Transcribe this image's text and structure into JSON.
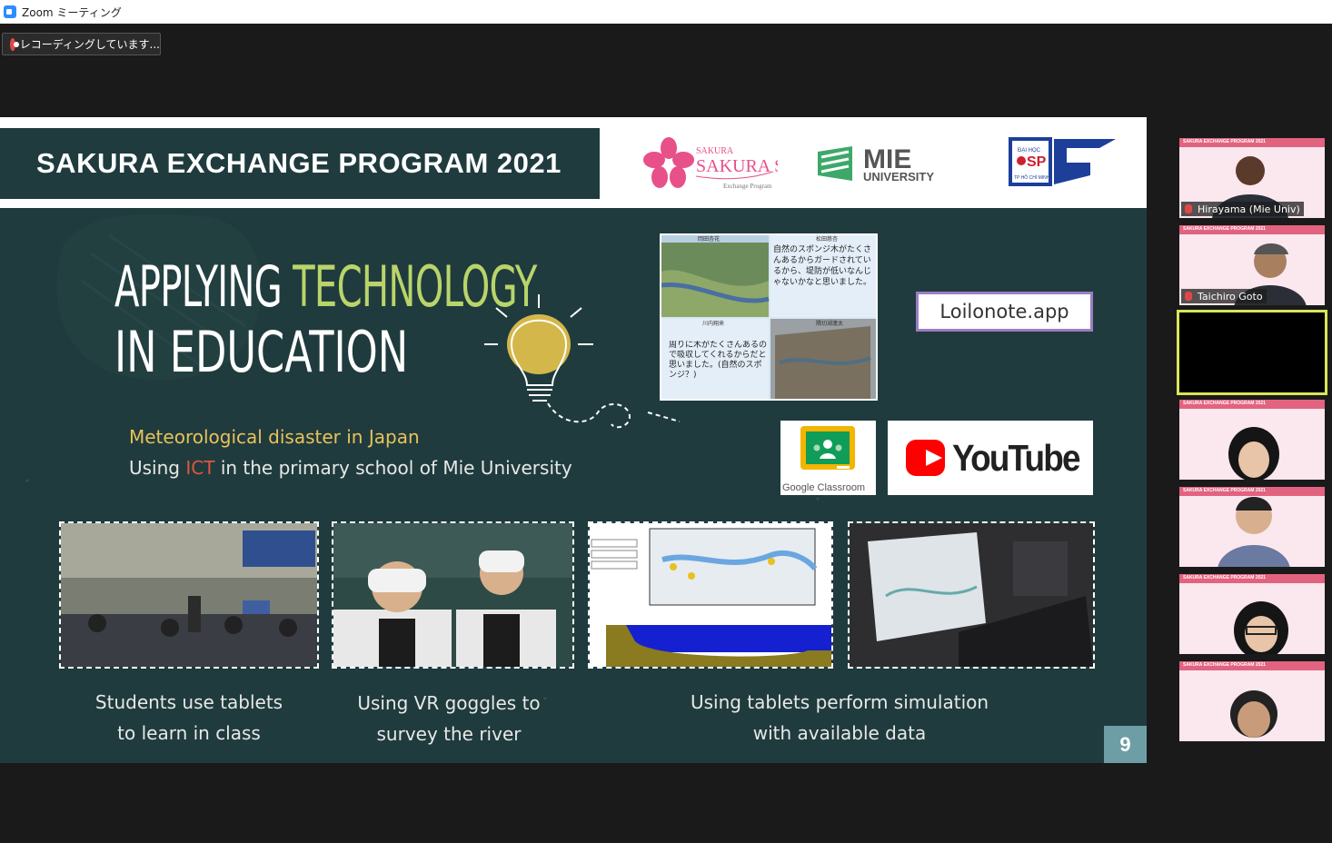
{
  "window": {
    "title": "Zoom ミーティング"
  },
  "recording": {
    "label": "レコーディングしています..."
  },
  "slide": {
    "header_title": "SAKURA EXCHANGE PROGRAM 2021",
    "title_white": "APPLYING",
    "title_green": "TECHNOLOGY",
    "title_line2": "IN EDUCATION",
    "subtitle1": "Meteorological disaster in Japan",
    "subtitle2_pre": "Using",
    "subtitle2_ict": "ICT",
    "subtitle2_post": "in the primary school of Mie University",
    "loilonote": "Loilonote.app",
    "google_classroom": "Google Classroom",
    "youtube": "YouTube",
    "captions": [
      {
        "line1": "Students use tablets",
        "line2": "to learn in class"
      },
      {
        "line1": "Using VR goggles to",
        "line2": "survey the river"
      },
      {
        "line1": "Using tablets perform simulation",
        "line2": "with available data"
      }
    ],
    "page_number": "9",
    "logos": {
      "sakura_science": "SAKURA SCIENCE",
      "sakura_sub": "Exchange Program",
      "mie": "MIE",
      "mie_univ": "UNIVERSITY",
      "sp": "SP",
      "sp_top": "ĐẠI HỌC",
      "sp_bottom": "TP HỒ CHÍ MINH"
    },
    "loilo_card": {
      "name_tl": "岡田杏花",
      "name_tr": "松田慈杏",
      "text_tr": "自然のスポンジ木がたくさんあるからガードされているから、堤防が低いなんじゃないかなと思いました。",
      "name_bl": "川内翔来",
      "text_bl": "周りに木がたくさんあるので吸収してくれるからだと思いました。(自然のスポンジ？)",
      "name_br": "隅切湖蓮太"
    }
  },
  "participants": [
    {
      "name": "Hirayama (Mie Univ)"
    },
    {
      "name": "Taichiro Goto"
    },
    {
      "name": ""
    },
    {
      "name": ""
    },
    {
      "name": ""
    },
    {
      "name": ""
    },
    {
      "name": ""
    }
  ],
  "tile_banner": "SAKURA EXCHANGE PROGRAM 2021",
  "colors": {
    "slide_bg": "#1f3b3d",
    "accent_green": "#b9d46a",
    "accent_yellow": "#e9c25b",
    "ict_red": "#e0563e",
    "active_border": "#d8e65a"
  }
}
